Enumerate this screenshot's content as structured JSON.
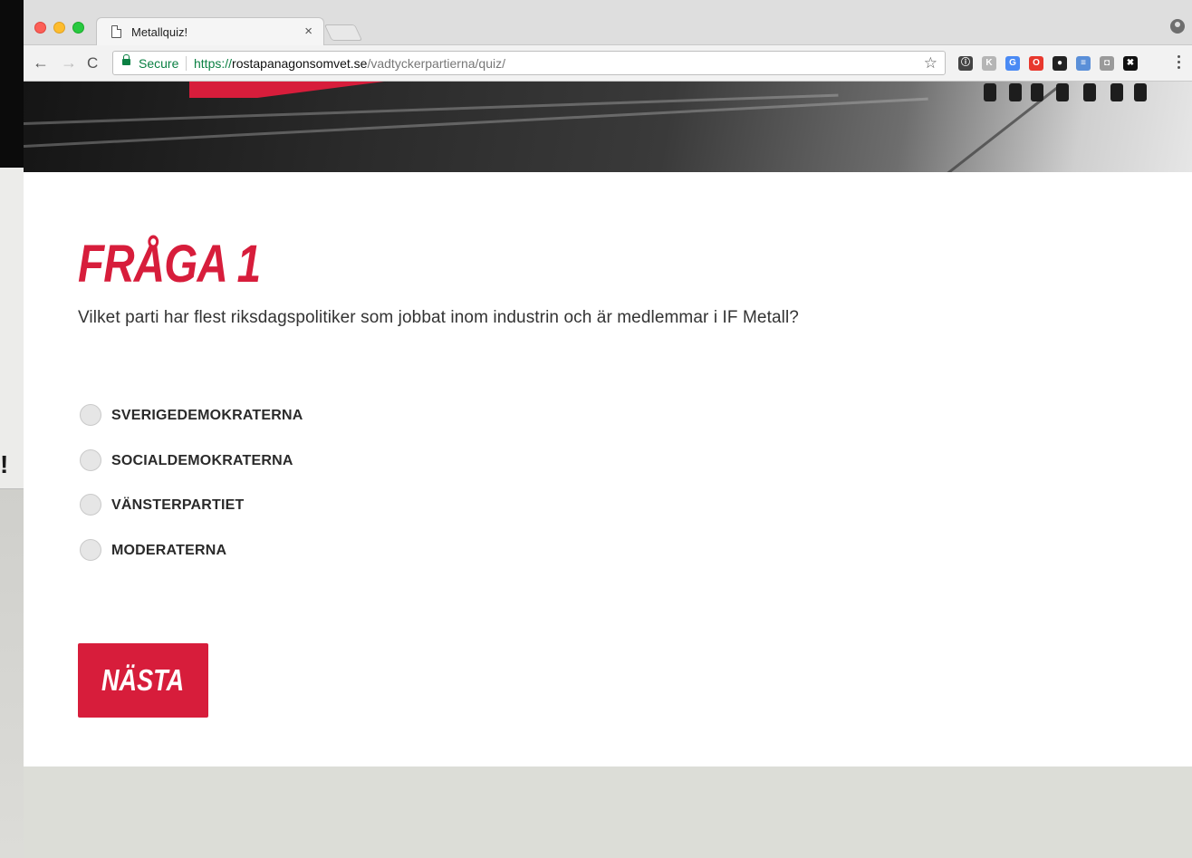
{
  "browser": {
    "tab_title": "Metallquiz!",
    "tab_close": "×",
    "secure_label": "Secure",
    "url_scheme": "https://",
    "url_host": "rostapanagonsomvet.se",
    "url_path": "/vadtyckerpartierna/quiz/",
    "back_glyph": "←",
    "forward_glyph": "→",
    "reload_glyph": "C",
    "star_glyph": "☆",
    "extensions": [
      {
        "icon": "info-icon",
        "label": "ⓘ",
        "color": "#444444"
      },
      {
        "icon": "extension-k-icon",
        "label": "K",
        "color": "#b5b5b5"
      },
      {
        "icon": "translate-icon",
        "label": "G",
        "color": "#4a8af4"
      },
      {
        "icon": "opera-icon",
        "label": "O",
        "color": "#e8382d"
      },
      {
        "icon": "color-wheel-icon",
        "label": "●",
        "color": "#222222"
      },
      {
        "icon": "stack-icon",
        "label": "≡",
        "color": "#5a8fd8"
      },
      {
        "icon": "camera-icon",
        "label": "◘",
        "color": "#9a9a9a"
      },
      {
        "icon": "cross-icon",
        "label": "✖",
        "color": "#111111"
      }
    ]
  },
  "background_window": {
    "mark": "!"
  },
  "quiz": {
    "title": "FRÅGA 1",
    "question": "Vilket parti har flest riksdagspolitiker som jobbat inom industrin och är medlemmar i IF Metall?",
    "options": [
      {
        "label": "SVERIGEDEMOKRATERNA"
      },
      {
        "label": "SOCIALDEMOKRATERNA"
      },
      {
        "label": "VÄNSTERPARTIET"
      },
      {
        "label": "MODERATERNA"
      }
    ],
    "next_label": "NÄSTA"
  },
  "colors": {
    "brand_red": "#d71d3b",
    "footer": "#dcddd7"
  }
}
